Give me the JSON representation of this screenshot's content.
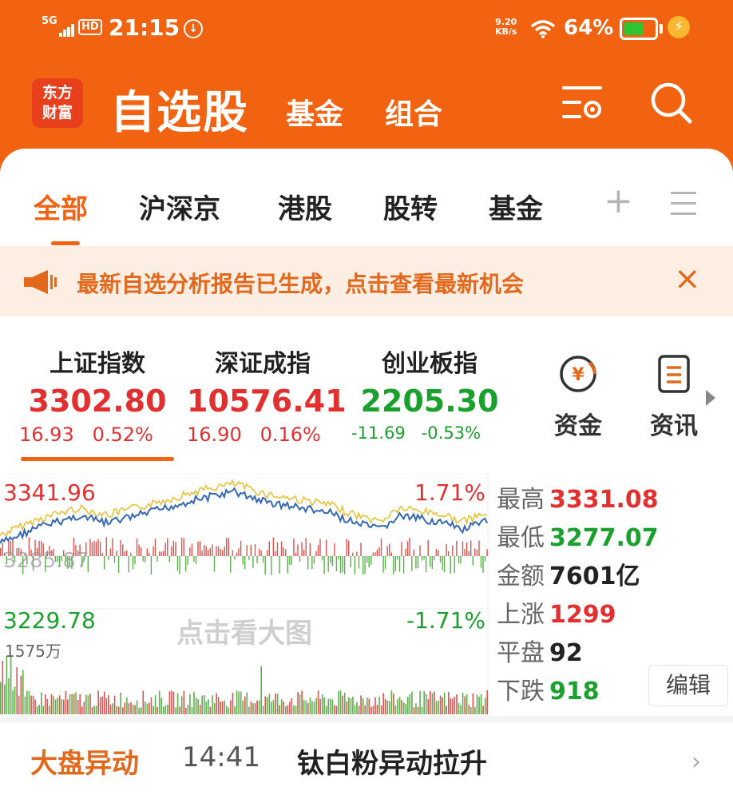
{
  "status_bar": {
    "network": "5G",
    "hd": "HD",
    "time": "21:15",
    "speed_value": "9.20",
    "speed_unit": "KB/s",
    "battery_pct": "64%",
    "battery_level": 0.64,
    "battery_color": "#2fc431",
    "icons": [
      "signal-bars-icon",
      "wifi-icon",
      "battery-icon",
      "charging-bolt-icon",
      "sync-icon"
    ]
  },
  "header": {
    "logo_line1": "东方",
    "logo_line2": "财富",
    "title": "自选股",
    "tabs": [
      "基金",
      "组合"
    ],
    "icons": [
      "settings-list-icon",
      "search-icon"
    ],
    "brand_color": "#f16311"
  },
  "categories": {
    "items": [
      "全部",
      "沪深京",
      "港股",
      "股转",
      "基金"
    ],
    "active": "全部",
    "add_symbol": "+",
    "icons": [
      "add-icon",
      "menu-icon"
    ]
  },
  "banner": {
    "text": "最新自选分析报告已生成，点击查看最新机会",
    "close": "×",
    "icons": [
      "megaphone-icon",
      "close-icon"
    ]
  },
  "indices": [
    {
      "name": "上证指数",
      "value": "3302.80",
      "change": "16.93",
      "pct": "0.52%",
      "trend": "up"
    },
    {
      "name": "深证成指",
      "value": "10576.41",
      "change": "16.90",
      "pct": "0.16%",
      "trend": "up"
    },
    {
      "name": "创业板指",
      "value": "2205.30",
      "change": "-11.69",
      "pct": "-0.53%",
      "trend": "down"
    }
  ],
  "quick_links": [
    {
      "label": "资金",
      "icon": "yuan-coin-icon"
    },
    {
      "label": "资讯",
      "icon": "document-icon"
    }
  ],
  "chart": {
    "high_label": "3341.96",
    "high_pct": "1.71%",
    "low_label": "3229.78",
    "low_pct": "-1.71%",
    "prev_close_label": "3285.87",
    "volume_label": "1575万",
    "hint": "点击看大图"
  },
  "stats": [
    {
      "key": "最高",
      "value": "3331.08",
      "color": "red"
    },
    {
      "key": "最低",
      "value": "3277.07",
      "color": "green"
    },
    {
      "key": "金额",
      "value": "7601亿",
      "color": "black"
    },
    {
      "key": "上涨",
      "value": "1299",
      "color": "red"
    },
    {
      "key": "平盘",
      "value": "92",
      "color": "black"
    },
    {
      "key": "下跌",
      "value": "918",
      "color": "green"
    }
  ],
  "edit_label": "编辑",
  "market_event": {
    "tag": "大盘异动",
    "time": "14:41",
    "text": "钛白粉异动拉升",
    "icon": "chevron-right-icon"
  },
  "colors": {
    "up": "#e23030",
    "down": "#1aa02d",
    "accent": "#f16311"
  }
}
